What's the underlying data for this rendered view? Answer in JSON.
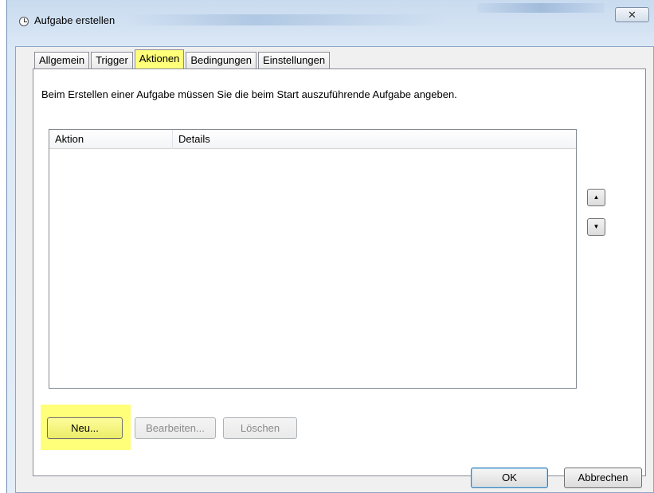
{
  "window": {
    "title": "Aufgabe erstellen",
    "close_glyph": "✕",
    "icon": "clock-icon"
  },
  "tabs": [
    {
      "label": "Allgemein",
      "active": false
    },
    {
      "label": "Trigger",
      "active": false
    },
    {
      "label": "Aktionen",
      "active": true
    },
    {
      "label": "Bedingungen",
      "active": false
    },
    {
      "label": "Einstellungen",
      "active": false
    }
  ],
  "instruction": "Beim Erstellen einer Aufgabe müssen Sie die beim Start auszuführende Aufgabe angeben.",
  "list": {
    "columns": [
      "Aktion",
      "Details"
    ],
    "rows": []
  },
  "reorder": {
    "up_glyph": "▲",
    "down_glyph": "▼"
  },
  "actions": {
    "new_label": "Neu...",
    "edit_label": "Bearbeiten...",
    "delete_label": "Löschen"
  },
  "dialog": {
    "ok_label": "OK",
    "cancel_label": "Abbrechen"
  },
  "colors": {
    "highlight": "#ffff7a",
    "titlebar": "#dbe8f6",
    "client_bg": "#f0f0f0"
  }
}
